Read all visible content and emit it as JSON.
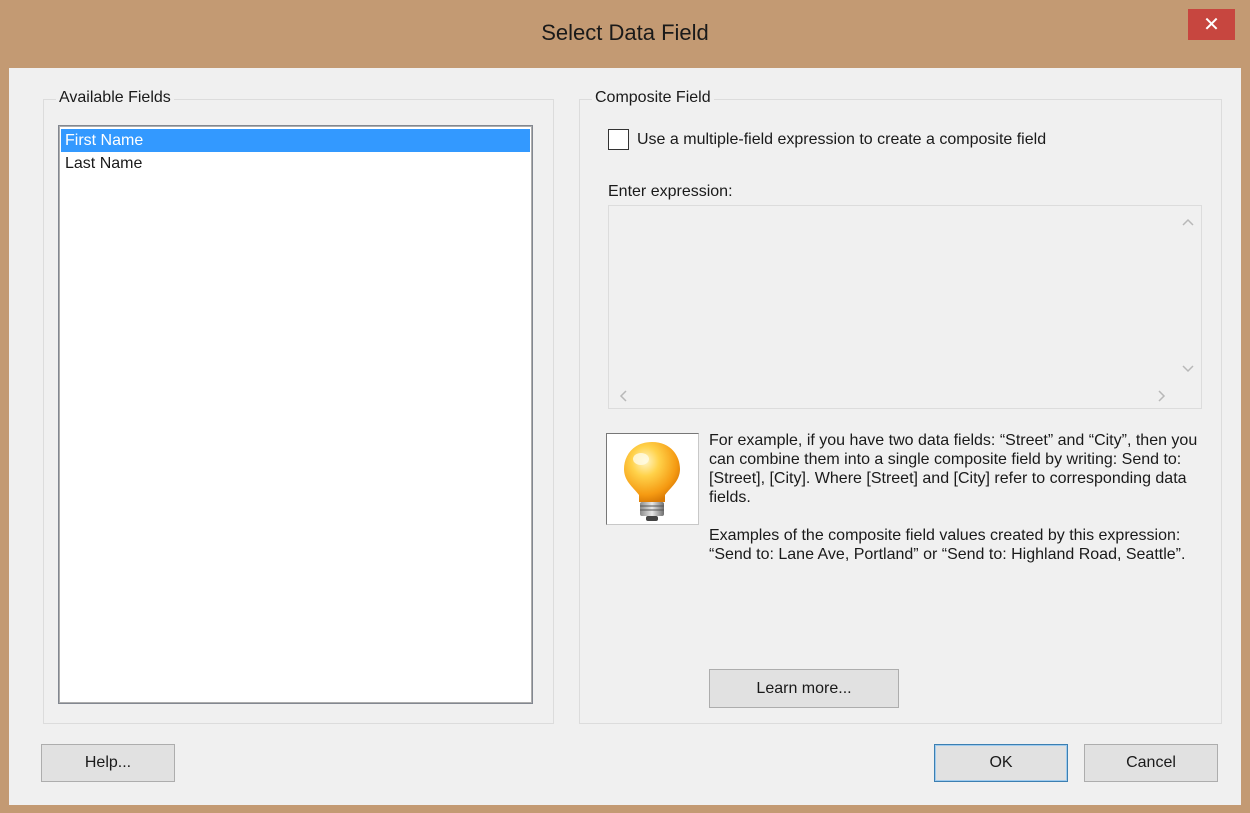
{
  "window": {
    "title": "Select Data Field",
    "close_glyph": "✕"
  },
  "available_fields": {
    "legend": "Available Fields",
    "items": [
      "First Name",
      "Last Name"
    ],
    "selected_index": 0
  },
  "composite_field": {
    "legend": "Composite Field",
    "checkbox_label": "Use a multiple-field expression to create a composite field",
    "checkbox_checked": false,
    "expression_label": "Enter expression:",
    "expression_value": "",
    "tip_icon": "lightbulb-icon",
    "tip_paragraph_1": "For example, if you have two data fields: “Street” and “City”, then you can combine them into a single composite field by writing: Send to: [Street], [City]. Where [Street] and [City] refer to corresponding data fields.",
    "tip_paragraph_2": "Examples of the composite field values created by this expression: “Send to: Lane Ave, Portland” or “Send to: Highland Road, Seattle”.",
    "learn_more_label": "Learn more..."
  },
  "buttons": {
    "help": "Help...",
    "ok": "OK",
    "cancel": "Cancel"
  },
  "colors": {
    "frame": "#c39a73",
    "close": "#c7463f",
    "selection": "#3399ff"
  }
}
